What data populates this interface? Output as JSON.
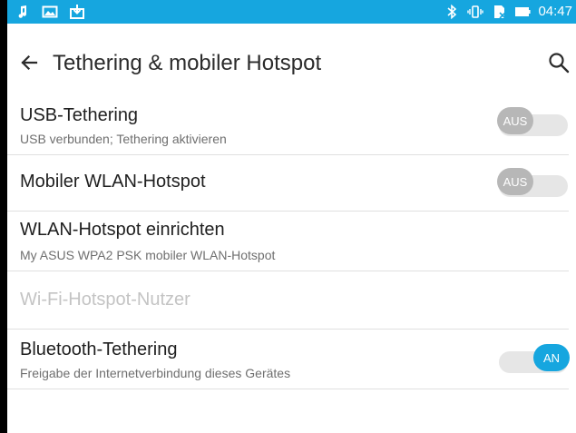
{
  "status_bar": {
    "time": "04:47",
    "left_icons": [
      "music-note-icon",
      "image-icon",
      "download-box-icon"
    ],
    "right_icons": [
      "bluetooth-icon",
      "vibrate-icon",
      "sim-icon",
      "battery-icon"
    ],
    "color": "#16a6df"
  },
  "app_bar": {
    "title": "Tethering & mobiler Hotspot",
    "back_icon": "arrow-back-icon",
    "search_icon": "search-icon"
  },
  "items": [
    {
      "title": "USB-Tethering",
      "subtitle": "USB verbunden; Tethering aktivieren",
      "toggle": "AUS",
      "toggle_state": "off"
    },
    {
      "title": "Mobiler WLAN-Hotspot",
      "toggle": "AUS",
      "toggle_state": "off"
    },
    {
      "title": "WLAN-Hotspot einrichten",
      "subtitle": "My ASUS WPA2 PSK mobiler WLAN-Hotspot"
    },
    {
      "title": "Wi-Fi-Hotspot-Nutzer",
      "disabled": true
    },
    {
      "title": "Bluetooth-Tethering",
      "subtitle": "Freigabe der Internetverbindung dieses Gerätes",
      "toggle": "AN",
      "toggle_state": "on"
    }
  ],
  "colors": {
    "accent": "#16a6df",
    "toggle_off": "#b7b7b7",
    "divider": "#e0e0e0"
  }
}
